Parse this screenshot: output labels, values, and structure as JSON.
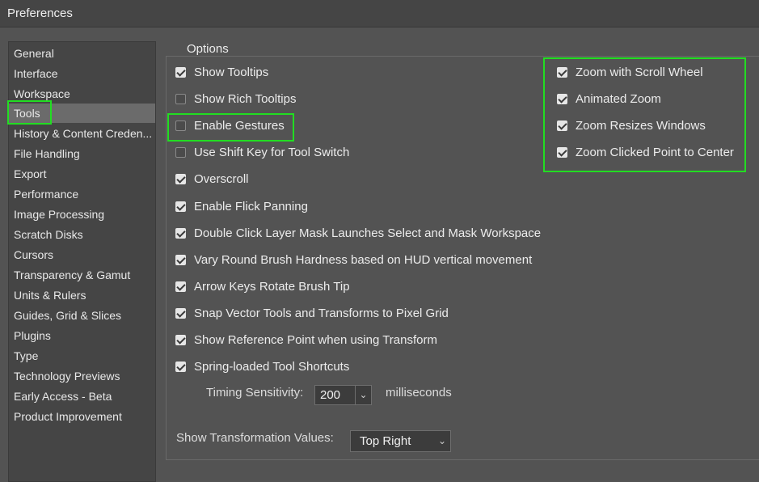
{
  "window": {
    "title": "Preferences"
  },
  "sidebar": {
    "items": [
      {
        "label": "General"
      },
      {
        "label": "Interface"
      },
      {
        "label": "Workspace"
      },
      {
        "label": "Tools",
        "selected": true
      },
      {
        "label": "History & Content Creden..."
      },
      {
        "label": "File Handling"
      },
      {
        "label": "Export"
      },
      {
        "label": "Performance"
      },
      {
        "label": "Image Processing"
      },
      {
        "label": "Scratch Disks"
      },
      {
        "label": "Cursors"
      },
      {
        "label": "Transparency & Gamut"
      },
      {
        "label": "Units & Rulers"
      },
      {
        "label": "Guides, Grid & Slices"
      },
      {
        "label": "Plugins"
      },
      {
        "label": "Type"
      },
      {
        "label": "Technology Previews"
      },
      {
        "label": "Early Access - Beta"
      },
      {
        "label": "Product Improvement"
      }
    ]
  },
  "options": {
    "legend": "Options",
    "left": [
      {
        "label": "Show Tooltips",
        "checked": true
      },
      {
        "label": "Show Rich Tooltips",
        "checked": false
      },
      {
        "label": "Enable Gestures",
        "checked": false
      },
      {
        "label": "Use Shift Key for Tool Switch",
        "checked": false
      },
      {
        "label": "Overscroll",
        "checked": true
      },
      {
        "label": "Enable Flick Panning",
        "checked": true
      },
      {
        "label": "Double Click Layer Mask Launches Select and Mask Workspace",
        "checked": true
      },
      {
        "label": "Vary Round Brush Hardness based on HUD vertical movement",
        "checked": true
      },
      {
        "label": "Arrow Keys Rotate Brush Tip",
        "checked": true
      },
      {
        "label": "Snap Vector Tools and Transforms to Pixel Grid",
        "checked": true
      },
      {
        "label": "Show Reference Point when using Transform",
        "checked": true
      },
      {
        "label": "Spring-loaded Tool Shortcuts",
        "checked": true
      }
    ],
    "right": [
      {
        "label": "Zoom with Scroll Wheel",
        "checked": true
      },
      {
        "label": "Animated Zoom",
        "checked": true
      },
      {
        "label": "Zoom Resizes Windows",
        "checked": true
      },
      {
        "label": "Zoom Clicked Point to Center",
        "checked": true
      }
    ],
    "timing": {
      "label": "Timing Sensitivity:",
      "value": "200",
      "unit": "milliseconds"
    },
    "transform_values": {
      "label": "Show Transformation Values:",
      "value": "Top Right"
    }
  },
  "colors": {
    "highlight": "#22dd22",
    "background": "#535353",
    "panel": "#454545",
    "selected": "#6b6b6b"
  },
  "icons": {
    "checkbox": "checkbox-icon",
    "dropdown": "chevron-down-icon"
  }
}
